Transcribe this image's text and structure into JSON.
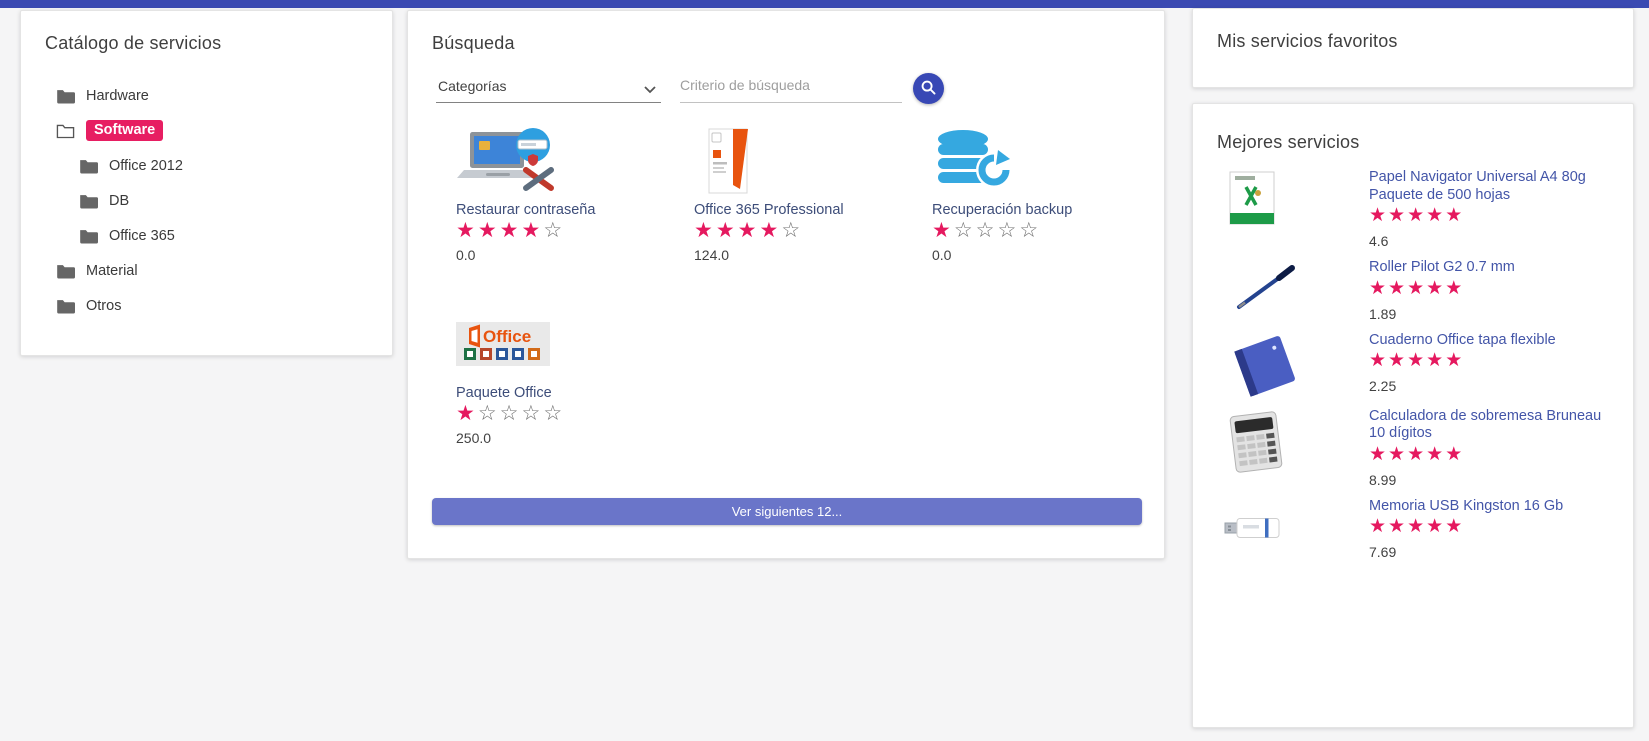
{
  "catalog": {
    "title": "Catálogo de servicios",
    "items": [
      {
        "label": "Hardware",
        "level": 1,
        "selected": false
      },
      {
        "label": "Software",
        "level": 1,
        "selected": true
      },
      {
        "label": "Office 2012",
        "level": 2,
        "selected": false
      },
      {
        "label": "DB",
        "level": 2,
        "selected": false
      },
      {
        "label": "Office 365",
        "level": 2,
        "selected": false
      },
      {
        "label": "Material",
        "level": 1,
        "selected": false
      },
      {
        "label": "Otros",
        "level": 1,
        "selected": false
      }
    ]
  },
  "search": {
    "title": "Búsqueda",
    "category_value": "Categorías",
    "input_placeholder": "Criterio de búsqueda",
    "more_label": "Ver siguientes 12...",
    "results": [
      {
        "name": "Restaurar contraseña",
        "rating": 4,
        "price": "0.0",
        "image": "password-restore"
      },
      {
        "name": "Office 365 Professional",
        "rating": 4,
        "price": "124.0",
        "image": "office-box"
      },
      {
        "name": "Recuperación backup",
        "rating": 1,
        "price": "0.0",
        "image": "backup-db"
      },
      {
        "name": "Paquete Office",
        "rating": 1,
        "price": "250.0",
        "image": "office-suite"
      }
    ]
  },
  "favorites": {
    "title": "Mis servicios favoritos"
  },
  "best": {
    "title": "Mejores servicios",
    "items": [
      {
        "name": "Papel Navigator Universal A4 80g Paquete de 500 hojas",
        "rating": 5,
        "price": "4.6",
        "image": "paper"
      },
      {
        "name": "Roller Pilot G2 0.7 mm",
        "rating": 5,
        "price": "1.89",
        "image": "pen"
      },
      {
        "name": "Cuaderno Office tapa flexible",
        "rating": 5,
        "price": "2.25",
        "image": "notebook"
      },
      {
        "name": "Calculadora de sobremesa Bruneau 10 dígitos",
        "rating": 5,
        "price": "8.99",
        "image": "calculator"
      },
      {
        "name": "Memoria USB Kingston 16 Gb",
        "rating": 5,
        "price": "7.69",
        "image": "usb"
      }
    ]
  },
  "colors": {
    "topbar": "#3b4ab2",
    "selected_chip": "#e71e62",
    "star_filled": "#e5195f",
    "more_button": "#6a75c9",
    "search_button": "#3848b5",
    "link_blue": "#4355a8"
  }
}
